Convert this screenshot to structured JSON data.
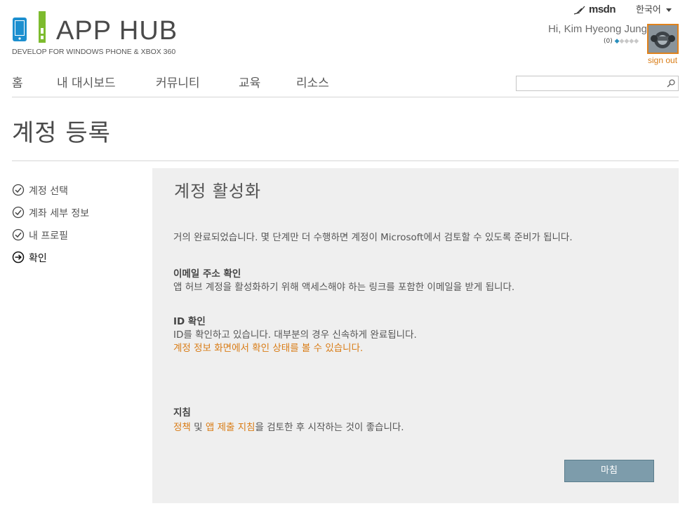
{
  "brand": {
    "title": "APP HUB",
    "tagline": "DEVELOP FOR WINDOWS PHONE & XBOX 360",
    "colors": {
      "phone_blue": "#1c8fcf",
      "xbox_green": "#7dbb2e",
      "accent_orange": "#d97c16"
    }
  },
  "topbar": {
    "msdn_label": "msdn",
    "language": "한국어",
    "greeting": "Hi, Kim Hyeong Jung",
    "reputation": "(0)",
    "signout": "sign out"
  },
  "nav": {
    "items": [
      {
        "label": "홈"
      },
      {
        "label": "내 대시보드"
      },
      {
        "label": "커뮤니티"
      },
      {
        "label": "교육"
      },
      {
        "label": "리소스"
      }
    ],
    "search_value": "",
    "search_placeholder": ""
  },
  "page": {
    "title": "계정 등록"
  },
  "steps": [
    {
      "label": "계정 선택",
      "status": "complete",
      "icon": "check-circle-icon"
    },
    {
      "label": "계좌 세부 정보",
      "status": "complete",
      "icon": "check-circle-icon"
    },
    {
      "label": "내 프로필",
      "status": "complete",
      "icon": "check-circle-icon"
    },
    {
      "label": "확인",
      "status": "current",
      "icon": "arrow-circle-icon"
    }
  ],
  "panel": {
    "title": "계정 활성화",
    "intro": "거의 완료되었습니다. 몇 단계만 더 수행하면 계정이 Microsoft에서 검토할 수 있도록 준비가 됩니다.",
    "email": {
      "heading": "이메일 주소 확인",
      "text": "앱 허브 계정을 활성화하기 위해 액세스해야 하는 링크를 포함한 이메일을 받게 됩니다."
    },
    "id": {
      "heading": "ID 확인",
      "text": "ID를 확인하고 있습니다. 대부분의 경우 신속하게 완료됩니다.",
      "link": "계정 정보 화면에서 확인 상태를 볼 수 있습니다."
    },
    "guidelines": {
      "heading": "지침",
      "link1": "정책",
      "sep": " 및 ",
      "link2": "앱 제출 지침",
      "rest": "을 검토한 후 시작하는 것이 좋습니다."
    },
    "finish_button": "마침"
  }
}
